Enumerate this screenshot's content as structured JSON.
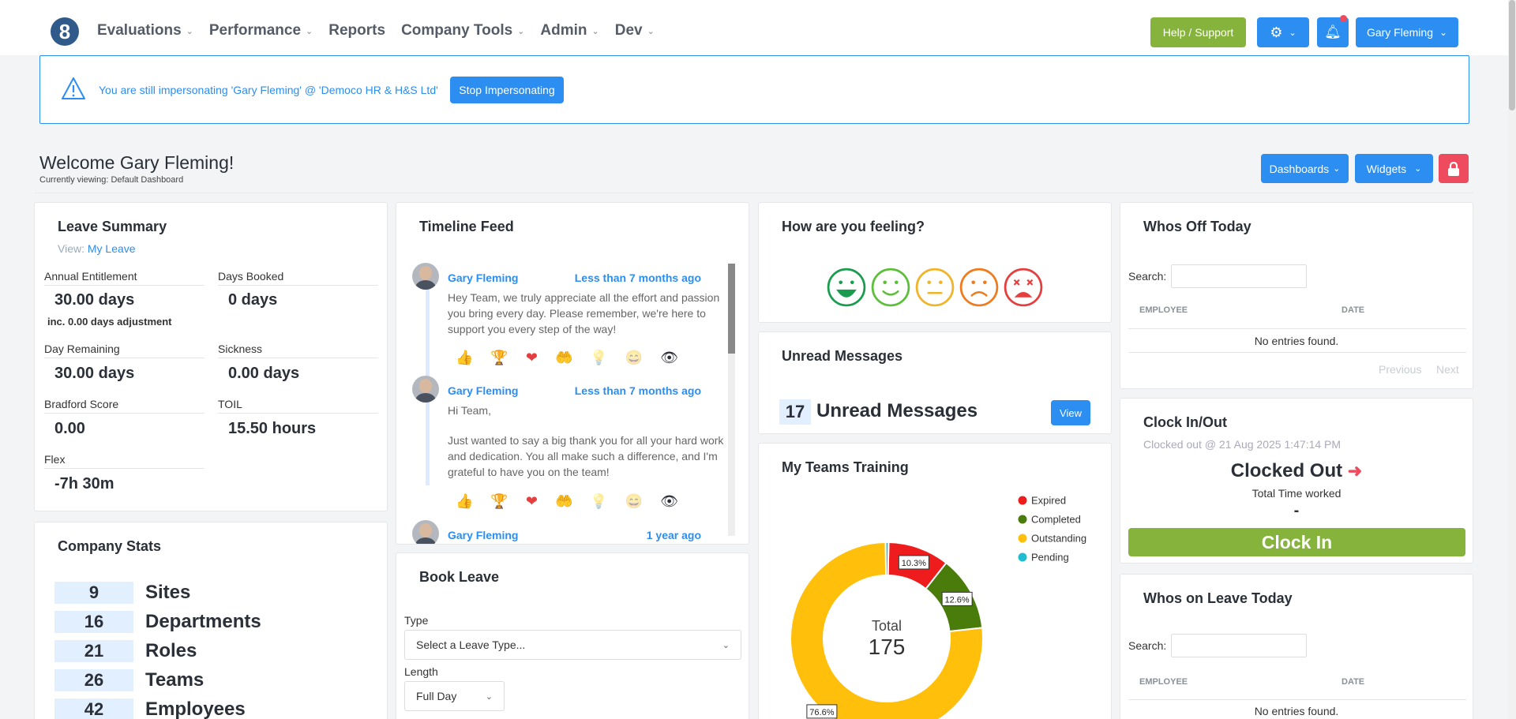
{
  "nav": {
    "logo": "8",
    "items": [
      {
        "label": "Evaluations",
        "caret": true
      },
      {
        "label": "Performance",
        "caret": true
      },
      {
        "label": "Reports",
        "caret": false
      },
      {
        "label": "Company Tools",
        "caret": true
      },
      {
        "label": "Admin",
        "caret": true
      },
      {
        "label": "Dev",
        "caret": true
      }
    ],
    "help_label": "Help / Support",
    "user_label": "Gary Fleming"
  },
  "alert": {
    "text": "You are still impersonating 'Gary Fleming' @ 'Democo HR & H&S Ltd'",
    "button": "Stop Impersonating"
  },
  "header": {
    "welcome": "Welcome Gary Fleming!",
    "viewing": "Currently viewing: Default Dashboard",
    "dashboards_label": "Dashboards",
    "widgets_label": "Widgets"
  },
  "leave_summary": {
    "title": "Leave Summary",
    "view_prefix": "View:",
    "view_link": "My Leave",
    "annual_label": "Annual Entitlement",
    "annual_value": "30.00 days",
    "adjustment": "inc. 0.00 days adjustment",
    "booked_label": "Days Booked",
    "booked_value": "0 days",
    "remaining_label": "Day Remaining",
    "remaining_value": "30.00 days",
    "sickness_label": "Sickness",
    "sickness_value": "0.00 days",
    "bradford_label": "Bradford Score",
    "bradford_value": "0.00",
    "toil_label": "TOIL",
    "toil_value": "15.50 hours",
    "flex_label": "Flex",
    "flex_value": "-7h 30m"
  },
  "company_stats": {
    "title": "Company Stats",
    "rows": [
      {
        "num": "9",
        "label": "Sites"
      },
      {
        "num": "16",
        "label": "Departments"
      },
      {
        "num": "21",
        "label": "Roles"
      },
      {
        "num": "26",
        "label": "Teams"
      },
      {
        "num": "42",
        "label": "Employees"
      }
    ]
  },
  "timeline": {
    "title": "Timeline Feed",
    "posts": [
      {
        "author": "Gary Fleming",
        "time": "Less than 7 months ago",
        "body": "Hey Team, we truly appreciate all the effort and passion you bring every day. Please remember, we're here to support you every step of the way!"
      },
      {
        "author": "Gary Fleming",
        "time": "Less than 7 months ago",
        "body_1": "Hi Team,",
        "body_2": "Just wanted to say a big thank you for all your hard work and dedication. You all make such a difference, and I'm grateful to have you on the team!"
      },
      {
        "author": "Gary Fleming",
        "time": "1 year ago"
      }
    ],
    "reactions": [
      "👍",
      "🏆",
      "❤",
      "🤲",
      "💡",
      "😄",
      "👁"
    ]
  },
  "book_leave": {
    "title": "Book Leave",
    "type_label": "Type",
    "type_placeholder": "Select a Leave Type...",
    "length_label": "Length",
    "length_value": "Full Day"
  },
  "feeling": {
    "title": "How are you feeling?",
    "faces": [
      "very-happy-face-icon",
      "happy-face-icon",
      "neutral-face-icon",
      "sad-face-icon",
      "very-sad-face-icon"
    ],
    "colors": [
      "#1a9c4e",
      "#5cbf3a",
      "#f0b429",
      "#f07b1d",
      "#e53e3e"
    ]
  },
  "unread": {
    "title": "Unread Messages",
    "count": "17",
    "label": "Unread Messages",
    "view_label": "View"
  },
  "training": {
    "title": "My Teams Training",
    "total_label": "Total",
    "total_value": "175"
  },
  "chart_data": {
    "type": "pie",
    "title": "My Teams Training",
    "categories": [
      "Expired",
      "Completed",
      "Outstanding",
      "Pending"
    ],
    "values": [
      10.3,
      12.6,
      76.6,
      0.5
    ],
    "colors": [
      "#ee1c1c",
      "#4a7c0c",
      "#ffbf0b",
      "#1fbcd2"
    ],
    "data_labels": [
      "10.3%",
      "12.6%",
      "76.6%",
      ""
    ],
    "center_label": "Total",
    "center_value": "175",
    "legend_position": "right"
  },
  "whos_off": {
    "title": "Whos Off Today",
    "search_label": "Search:",
    "col_employee": "EMPLOYEE",
    "col_date": "DATE",
    "empty": "No entries found.",
    "prev": "Previous",
    "next": "Next"
  },
  "clock": {
    "title": "Clock In/Out",
    "last": "Clocked out @ 21 Aug 2025 1:47:14 PM",
    "status": "Clocked Out",
    "total_label": "Total Time worked",
    "total_value": "-",
    "button": "Clock In"
  },
  "whos_leave": {
    "title": "Whos on Leave Today",
    "search_label": "Search:",
    "col_employee": "EMPLOYEE",
    "col_date": "DATE",
    "empty": "No entries found."
  }
}
